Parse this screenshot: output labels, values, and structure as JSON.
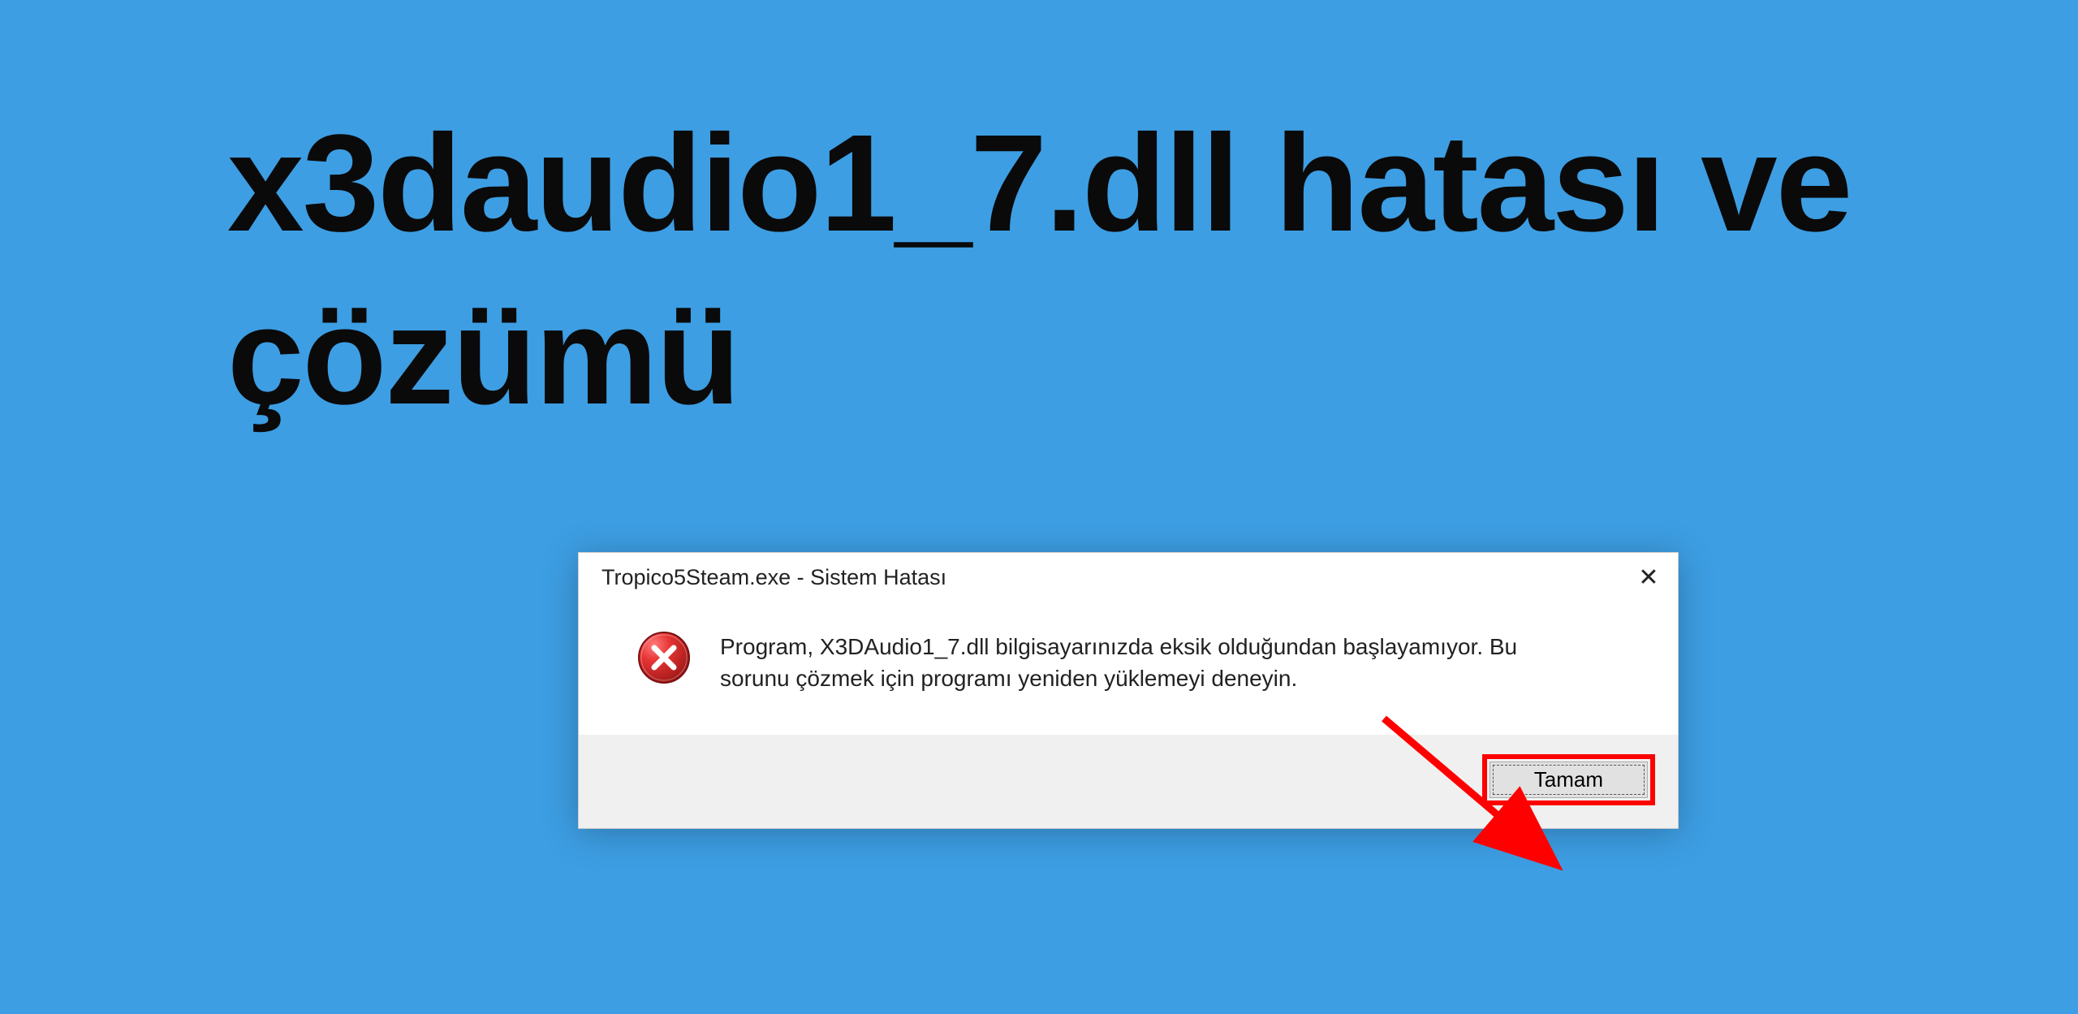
{
  "headline": "x3daudio1_7.dll hatası ve çözümü",
  "dialog": {
    "title": "Tropico5Steam.exe - Sistem Hatası",
    "message": "Program, X3DAudio1_7.dll bilgisayarınızda eksik olduğundan başlayamıyor. Bu sorunu çözmek için programı yeniden yüklemeyi deneyin.",
    "ok_label": "Tamam",
    "close_symbol": "✕"
  },
  "colors": {
    "background": "#3d9ee3",
    "highlight": "#ff0000"
  }
}
